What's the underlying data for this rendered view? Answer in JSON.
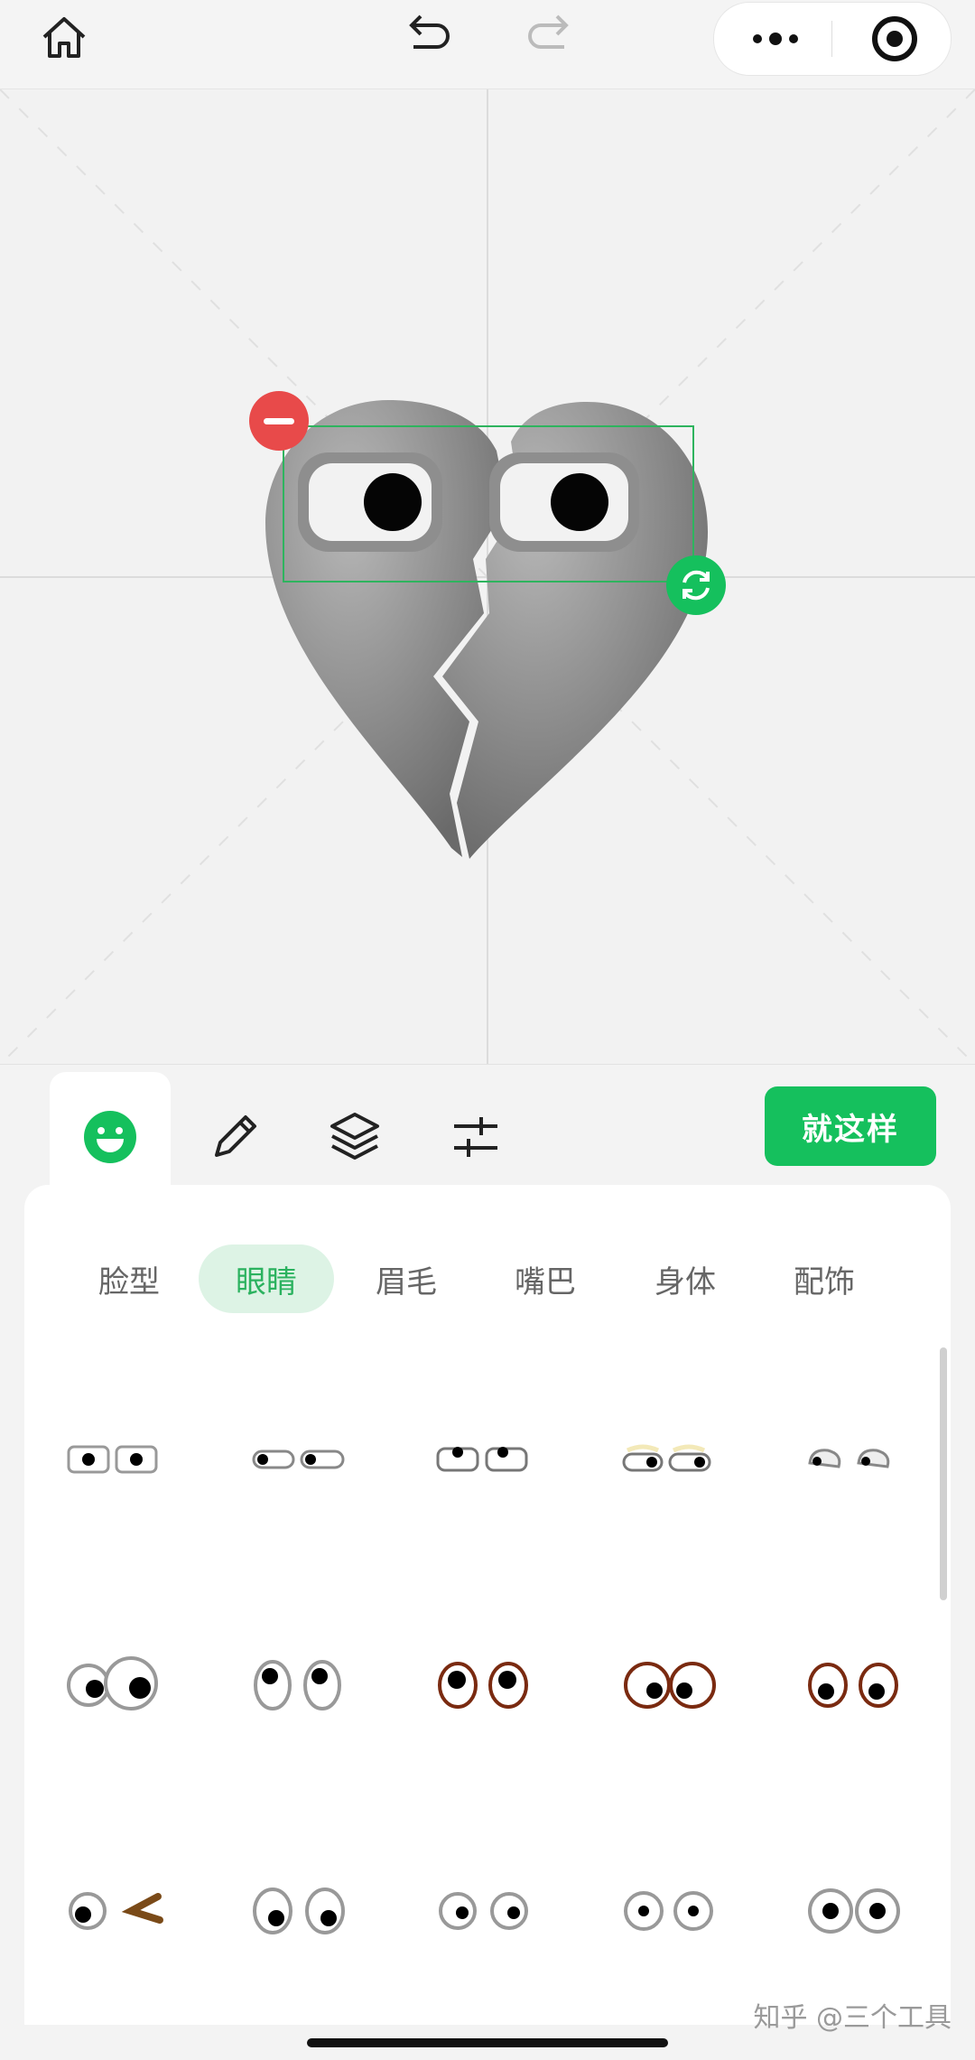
{
  "topbar": {
    "icons": [
      "home-icon",
      "undo-icon",
      "redo-icon",
      "more-icon",
      "record-icon"
    ]
  },
  "editor": {
    "sticker": "broken-heart-with-eyes",
    "handles": [
      "delete-handle",
      "rotate-handle"
    ],
    "accent_color": "#15c05d",
    "delete_color": "#e84a4a"
  },
  "toolbar": {
    "tools": [
      "face-tool-icon",
      "pencil-icon",
      "layers-icon",
      "adjust-icon"
    ],
    "confirm_label": "就这样"
  },
  "panel": {
    "tabs": [
      "脸型",
      "眼睛",
      "眉毛",
      "嘴巴",
      "身体",
      "配饰"
    ],
    "active_tab": "眼睛",
    "items": [
      "eyes-rect-small",
      "eyes-pill-left",
      "eyes-half-top",
      "eyes-glow-right",
      "eyes-sleepy",
      "eyes-big-googly",
      "eyes-oval-up",
      "eyes-brown-round",
      "eyes-brown-wide",
      "eyes-brown-down",
      "eyes-wink-brow",
      "eyes-oval-down",
      "eyes-small-round",
      "eyes-center-dot",
      "eyes-bold-round"
    ]
  },
  "watermark": "知乎 @三个工具"
}
